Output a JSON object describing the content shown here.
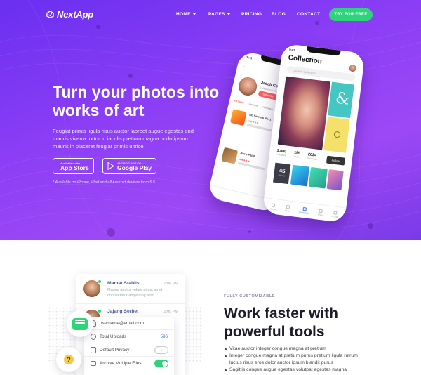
{
  "nav": {
    "brand": "NextApp",
    "items": [
      {
        "label": "HOME",
        "dropdown": true
      },
      {
        "label": "PAGES",
        "dropdown": true
      },
      {
        "label": "PRICING",
        "dropdown": false
      },
      {
        "label": "BLOG",
        "dropdown": false
      },
      {
        "label": "CONTACT",
        "dropdown": false
      }
    ],
    "cta": "TRY FOR FREE"
  },
  "hero": {
    "headline": "Turn your photos into works of art",
    "lead": "Feugiat primis ligula risus auctor laoreet augue egestas and mauris viverra tortor in iaculis pretium magna undo ipsum mauris in placerat feugiat primis ultrice",
    "app_store": {
      "small": "Available on the",
      "big": "App Store"
    },
    "google_play": {
      "small": "ANDROID APP ON",
      "big": "Google Play"
    },
    "availability": "* Available on iPhone, iPad and all Android devices from 5.5"
  },
  "phone_profile": {
    "time": "9:41",
    "name": "Jacob Coleman",
    "subtitle": "Collections / Photos",
    "button": "Subscribe",
    "tabs": [
      "Art Items",
      "Reviews",
      "Followers"
    ],
    "items": [
      {
        "title": "Art Secrets No. 1",
        "stars": "★★★★★"
      },
      {
        "title": "Jon's Paint",
        "stars": "★★★★★"
      }
    ]
  },
  "phone_collection": {
    "time": "9:41",
    "title": "Collection",
    "search_placeholder": "Search Collection",
    "stats": [
      {
        "n": "1,600",
        "l": "Followers"
      },
      {
        "n": "1M",
        "l": "Likes"
      },
      {
        "n": "2024",
        "l": "Downloads"
      }
    ],
    "follow": "Follow",
    "count": {
      "n": "45",
      "l": "Photos"
    },
    "tabbar": [
      "Home",
      "Music",
      "Collection",
      "Shop",
      "Profile"
    ],
    "active_tab": 2
  },
  "chat": {
    "messages": [
      {
        "name": "Mamat Stablis",
        "time": "2:04 PM",
        "text": "Magna auctor volute at est amet, connectetur adipiscing erat"
      },
      {
        "name": "Jajang Serbet",
        "time": "2:00 PM",
        "text": ""
      }
    ]
  },
  "settings": {
    "rows": [
      {
        "label": "username@email.com",
        "icon": "user-icon",
        "type": "text",
        "value": ""
      },
      {
        "label": "Total Uploads",
        "icon": "upload-icon",
        "type": "value",
        "value": "596"
      },
      {
        "label": "Default Privacy",
        "icon": "lock-icon",
        "type": "toggle",
        "on": false
      },
      {
        "label": "Archive Multiple Files",
        "icon": "archive-icon",
        "type": "toggle",
        "on": true
      }
    ]
  },
  "features": {
    "eyebrow": "FULLY CUSTOMIZABLE",
    "title": "Work faster with powerful tools",
    "bullets": [
      "Vitae auctor integer congue magna at pretium",
      "Integer congue magna at pretium purus pretium ligula rutrum luctus risus eros dolor auctor ipsum blandit purus",
      "Sagittis congue augue egestas volutpat egestas magna"
    ]
  },
  "colors": {
    "hero_purple": "#8b3ef5",
    "cta_green": "#2ed47a",
    "accent_blue": "#3b6cff",
    "accent_red": "#ff5d5d"
  }
}
